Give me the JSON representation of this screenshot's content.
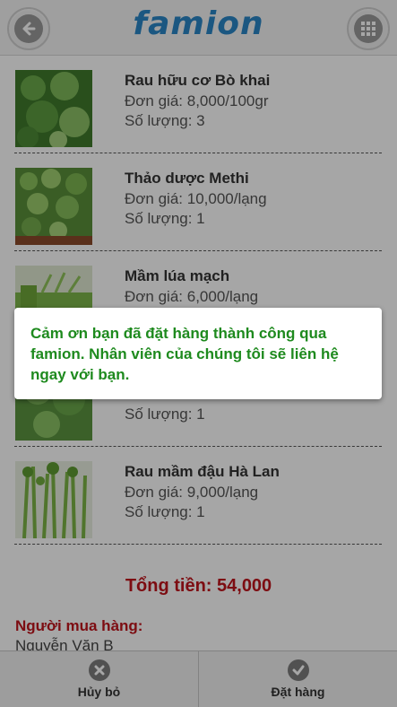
{
  "header": {
    "logo_text": "famion",
    "back_icon": "back-arrow-icon",
    "menu_icon": "grid-menu-icon"
  },
  "cart": {
    "items": [
      {
        "name": "Rau hữu cơ Bò khai",
        "price": "Đơn giá: 8,000/100gr",
        "qty": "Số lượng: 3"
      },
      {
        "name": "Thảo dược Methi",
        "price": "Đơn giá: 10,000/lạng",
        "qty": "Số lượng: 1"
      },
      {
        "name": "Mầm lúa mạch",
        "price": "Đơn giá: 6,000/lạng",
        "qty": ""
      },
      {
        "name": "",
        "price": "",
        "qty": "Số lượng: 1"
      },
      {
        "name": "Rau mầm đậu Hà Lan",
        "price": "Đơn giá: 9,000/lạng",
        "qty": "Số lượng: 1"
      }
    ],
    "total_text": "Tổng tiền: 54,000",
    "buyer_label": "Người mua hàng:",
    "buyer_name": "Nguyễn Văn B"
  },
  "footer": {
    "cancel_label": "Hủy bỏ",
    "order_label": "Đặt hàng"
  },
  "dialog": {
    "message": "Cảm ơn bạn đã đặt hàng thành công qua famion. Nhân viên của chúng tôi sẽ liên hệ ngay với bạn."
  },
  "colors": {
    "brand": "#2a86c6",
    "total": "#c0141c",
    "success": "#1e8a1e"
  }
}
